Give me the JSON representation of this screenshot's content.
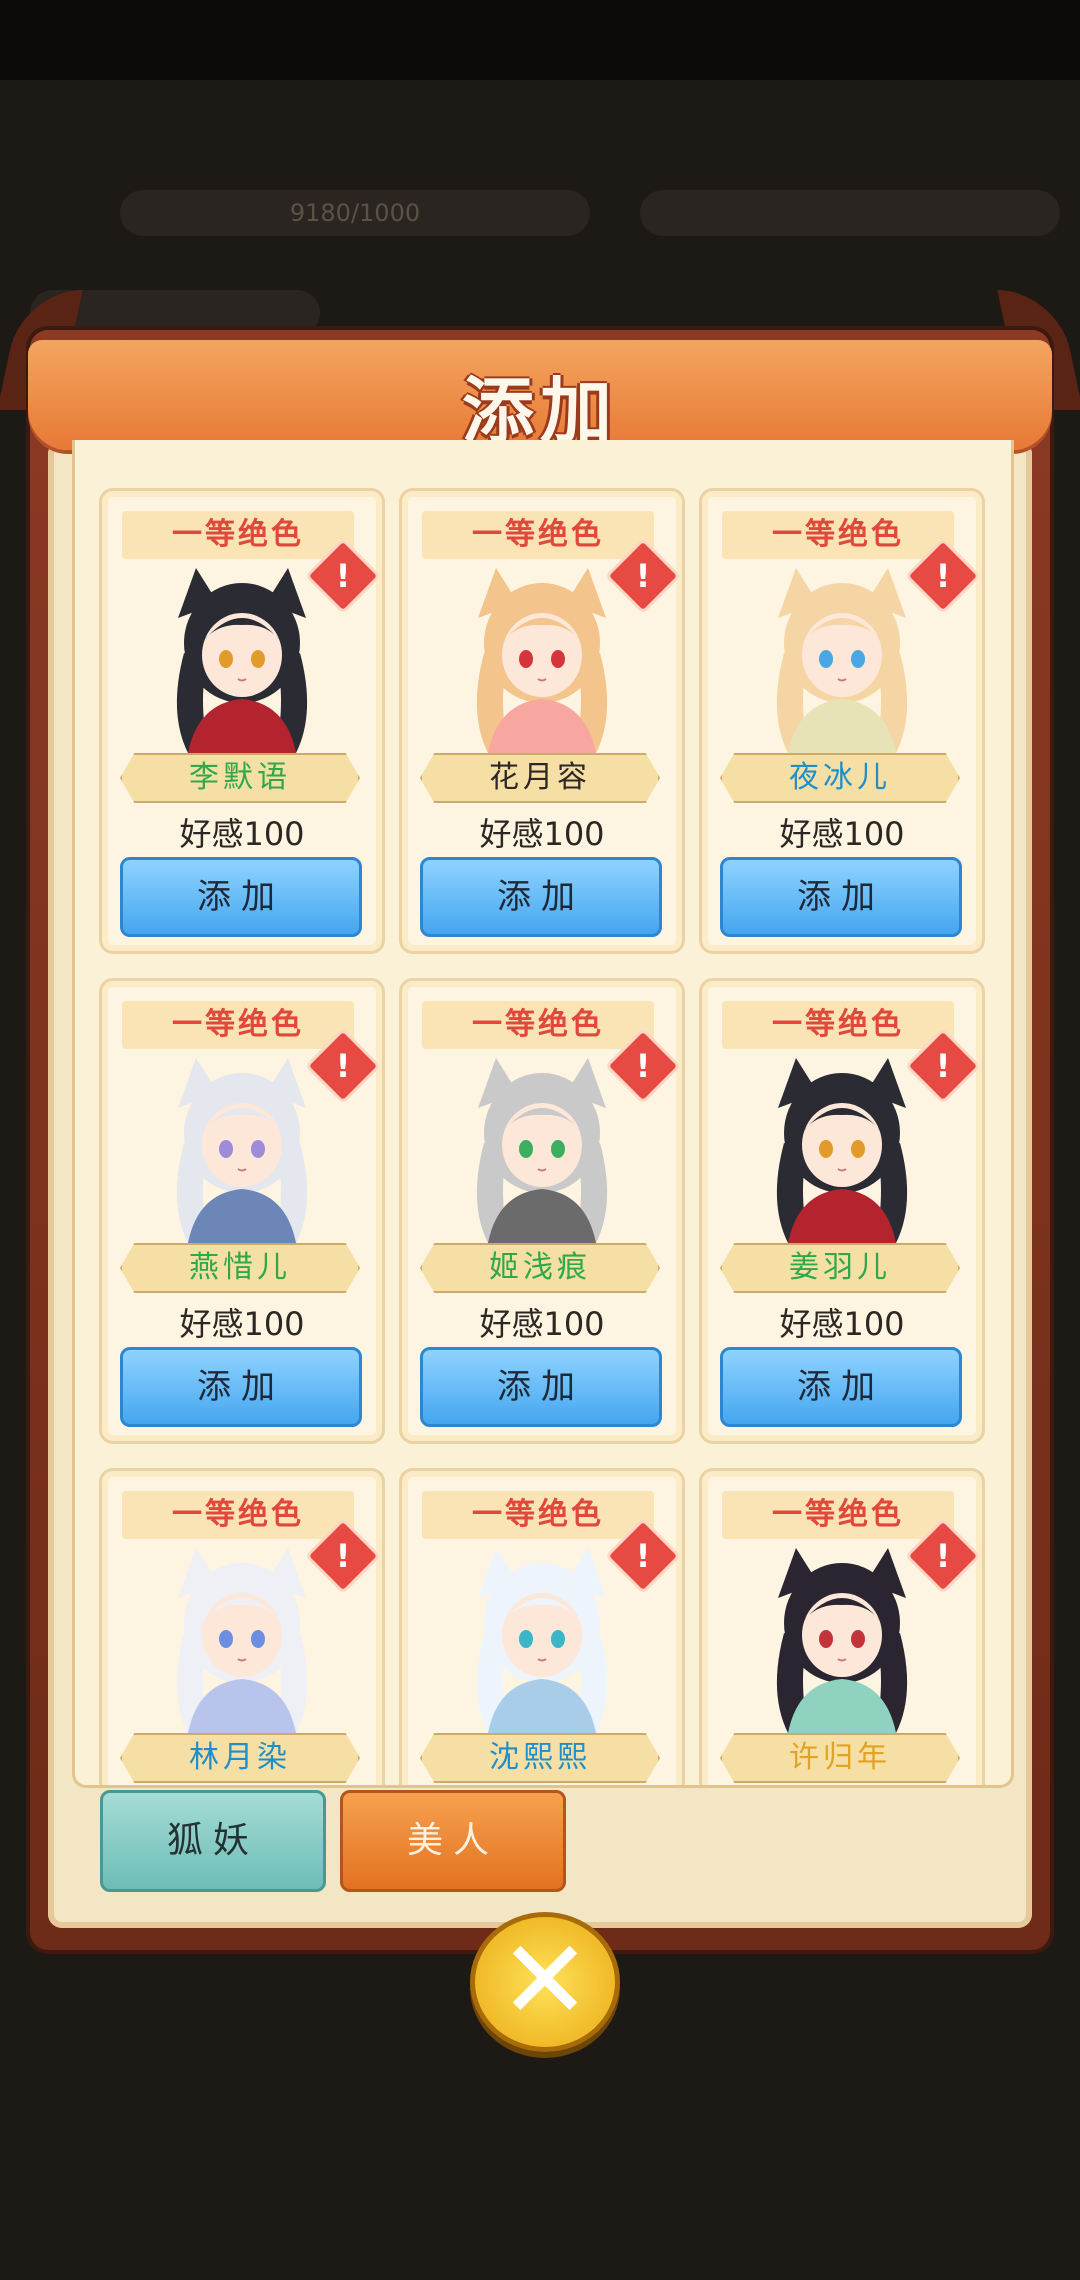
{
  "background": {
    "bar_text": "9180/1000"
  },
  "modal": {
    "title": "添加"
  },
  "cards": [
    {
      "grade": "一等绝色",
      "name": "李默语",
      "name_color": "#2fa84a",
      "affinity": "好感100",
      "button": "添加",
      "hair": "#2b2b34",
      "outfit": "#b4242f",
      "eye": "#e39a2c"
    },
    {
      "grade": "一等绝色",
      "name": "花月容",
      "name_color": "#2c2723",
      "affinity": "好感100",
      "button": "添加",
      "hair": "#f3c48b",
      "outfit": "#f7a6a0",
      "eye": "#d6333a"
    },
    {
      "grade": "一等绝色",
      "name": "夜冰儿",
      "name_color": "#1f8fc9",
      "affinity": "好感100",
      "button": "添加",
      "hair": "#f6d5a4",
      "outfit": "#e8e3b6",
      "eye": "#4aa7e6"
    },
    {
      "grade": "一等绝色",
      "name": "燕惜儿",
      "name_color": "#2fa84a",
      "affinity": "好感100",
      "button": "添加",
      "hair": "#e5e7ee",
      "outfit": "#6b86b7",
      "eye": "#9c8cd9"
    },
    {
      "grade": "一等绝色",
      "name": "姬浅痕",
      "name_color": "#2fa84a",
      "affinity": "好感100",
      "button": "添加",
      "hair": "#c9c9c9",
      "outfit": "#6b6b6b",
      "eye": "#3caf5e"
    },
    {
      "grade": "一等绝色",
      "name": "姜羽儿",
      "name_color": "#2fa84a",
      "affinity": "好感100",
      "button": "添加",
      "hair": "#2b2b34",
      "outfit": "#b4242f",
      "eye": "#e39a2c"
    },
    {
      "grade": "一等绝色",
      "name": "林月染",
      "name_color": "#1f8fc9",
      "affinity": "",
      "button": "",
      "hair": "#eef0f6",
      "outfit": "#b9c4ec",
      "eye": "#6a8fe0"
    },
    {
      "grade": "一等绝色",
      "name": "沈熙熙",
      "name_color": "#1f8fc9",
      "affinity": "",
      "button": "",
      "hair": "#eef4fb",
      "outfit": "#a9cde8",
      "eye": "#3bb6c9"
    },
    {
      "grade": "一等绝色",
      "name": "许归年",
      "name_color": "#e0a323",
      "affinity": "",
      "button": "",
      "hair": "#2a2530",
      "outfit": "#8fd2c0",
      "eye": "#c2333a"
    }
  ],
  "tabs": {
    "fox": "狐妖",
    "beauty": "美人"
  },
  "close_icon": "close-x-icon"
}
